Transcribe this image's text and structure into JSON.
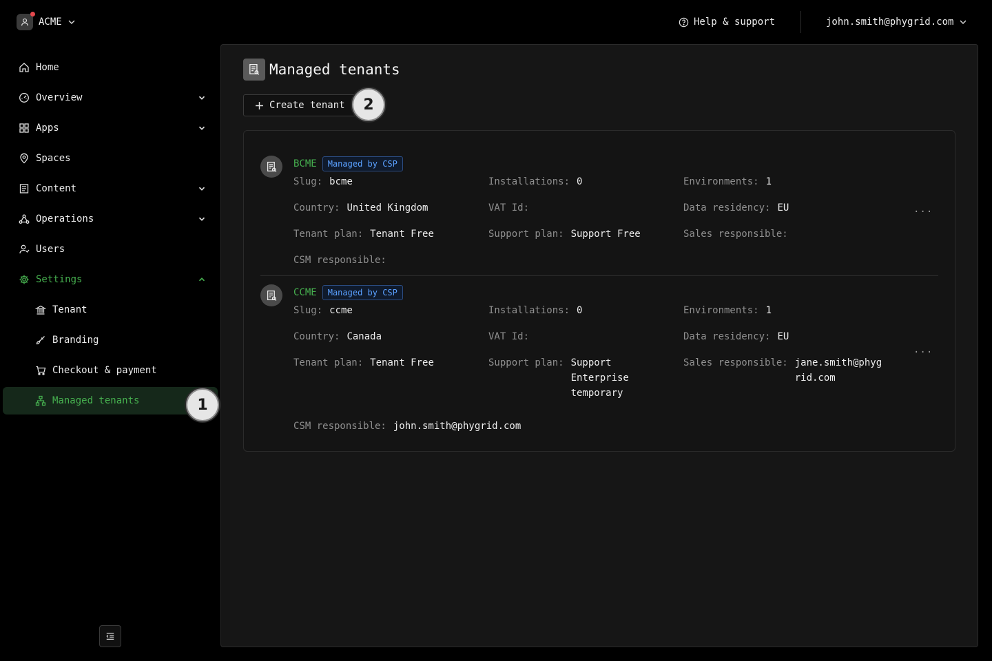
{
  "org": {
    "name": "ACME"
  },
  "topbar": {
    "help_label": "Help & support",
    "user_email": "john.smith@phygrid.com"
  },
  "nav": {
    "items": [
      {
        "label": "Home"
      },
      {
        "label": "Overview"
      },
      {
        "label": "Apps"
      },
      {
        "label": "Spaces"
      },
      {
        "label": "Content"
      },
      {
        "label": "Operations"
      },
      {
        "label": "Users"
      },
      {
        "label": "Settings"
      }
    ],
    "settings_sub": [
      {
        "label": "Tenant"
      },
      {
        "label": "Branding"
      },
      {
        "label": "Checkout & payment"
      },
      {
        "label": "Managed tenants"
      }
    ]
  },
  "steps": {
    "one": "1",
    "two": "2"
  },
  "page": {
    "title": "Managed tenants",
    "create_label": "Create tenant"
  },
  "labels": {
    "slug": "Slug:",
    "installations": "Installations:",
    "environments": "Environments:",
    "country": "Country:",
    "vat": "VAT Id:",
    "residency": "Data residency:",
    "tenant_plan": "Tenant plan:",
    "support_plan": "Support plan:",
    "sales": "Sales responsible:",
    "csm": "CSM responsible:"
  },
  "tenants": [
    {
      "name": "BCME",
      "badge": "Managed by CSP",
      "slug": "bcme",
      "installations": "0",
      "environments": "1",
      "country": "United Kingdom",
      "vat": "",
      "residency": "EU",
      "tenant_plan": "Tenant Free",
      "support_plan": "Support Free",
      "sales": "",
      "csm": "",
      "more": "..."
    },
    {
      "name": "CCME",
      "badge": "Managed by CSP",
      "slug": "ccme",
      "installations": "0",
      "environments": "1",
      "country": "Canada",
      "vat": "",
      "residency": "EU",
      "tenant_plan": "Tenant Free",
      "support_plan": "Support Enterprise temporary",
      "sales": "jane.smith@phygrid.com",
      "csm": "john.smith@phygrid.com",
      "more": "..."
    }
  ],
  "colors": {
    "accent": "#46b04f",
    "badge": "#5aa0ff",
    "panel": "#161616"
  },
  "icons": [
    "user-icon",
    "chevron-down-icon",
    "help-circle-icon",
    "home-icon",
    "gauge-icon",
    "grid-icon",
    "map-pin-icon",
    "document-icon",
    "network-icon",
    "users-icon",
    "gear-icon",
    "bank-icon",
    "brush-icon",
    "cart-icon",
    "sitemap-icon",
    "plus-icon",
    "collapse-icon",
    "tenant-doc-icon"
  ]
}
